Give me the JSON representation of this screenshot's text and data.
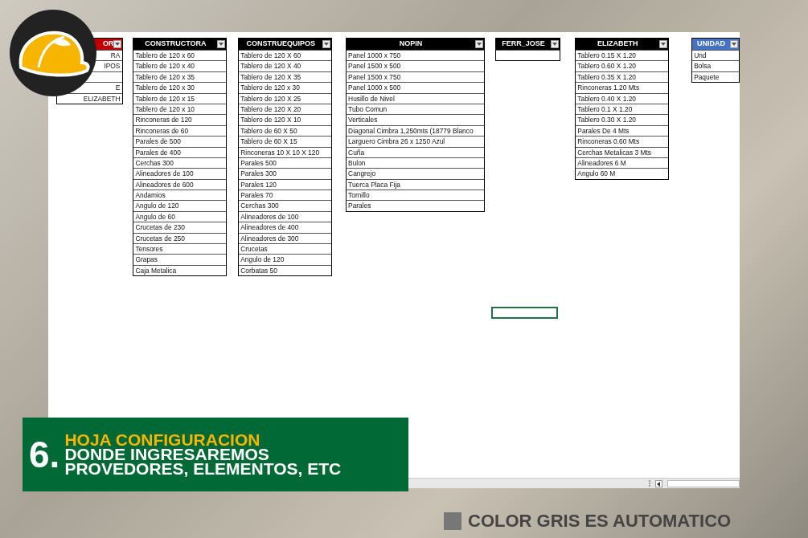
{
  "tables": [
    {
      "header": "OR",
      "color": "#c00000",
      "rows": [
        {
          "text": "RA"
        },
        {
          "text": "IPOS"
        },
        {},
        {
          "text": "E"
        },
        {
          "text": "ELIZABETH"
        }
      ]
    },
    {
      "header": "CONSTRUCTORA",
      "color": "#000000",
      "rows": [
        {
          "text": "Tablero de 120 x 60"
        },
        {
          "text": "Tablero de 120 x 40"
        },
        {
          "text": "Tablero de 120 x 35"
        },
        {
          "text": "Tablero de 120 x 30"
        },
        {
          "text": "Tablero de 120 x 15"
        },
        {
          "text": "Tablero de 120 x 10"
        },
        {
          "text": "Rinconeras de 120"
        },
        {
          "text": "Rinconeras de 60"
        },
        {
          "text": "Parales de 500"
        },
        {
          "text": "Parales de 400"
        },
        {
          "text": "Cerchas 300"
        },
        {
          "text": "Alineadores de 100"
        },
        {
          "text": "Alineadores de 600"
        },
        {
          "text": "Andamios"
        },
        {
          "text": "Angulo de 120"
        },
        {
          "text": "Angulo de 60"
        },
        {
          "text": "Crucetas de 230"
        },
        {
          "text": "Crucetas de 250"
        },
        {
          "text": "Tensores"
        },
        {
          "text": "Grapas"
        },
        {
          "text": "Caja Metalica"
        }
      ]
    },
    {
      "header": "CONSTRUEQUIPOS",
      "color": "#000000",
      "rows": [
        {
          "text": "Tablero de 120 X 60"
        },
        {
          "text": "Tablero de 120 X 40"
        },
        {
          "text": "Tablero de 120 X 35"
        },
        {
          "text": "Tablero de 120 x 30"
        },
        {
          "text": "Tablero de 120 X 25"
        },
        {
          "text": "Tablero de 120 X 20"
        },
        {
          "text": "Tablero de 120 X 10"
        },
        {
          "text": "Tablero de 60 X 50"
        },
        {
          "text": "Tablero de 60 X 15"
        },
        {
          "text": "Rinconeras 10 X 10 X 120"
        },
        {
          "text": "Parales 500"
        },
        {
          "text": "Parales 300"
        },
        {
          "text": "Parales 120"
        },
        {
          "text": "Parales 70"
        },
        {
          "text": "Cerchas 300"
        },
        {
          "text": "Alineadores  de 100"
        },
        {
          "text": "Alineadores  de 400"
        },
        {
          "text": "Alineadores de 300"
        },
        {
          "text": "Crucetas"
        },
        {
          "text": "Angulo de 120"
        },
        {
          "text": "Corbatas  50"
        }
      ]
    },
    {
      "header": "NOPIN",
      "color": "#000000",
      "rows": [
        {
          "text": "Panel 1000 x 750"
        },
        {
          "text": "Panel 1500 x 500"
        },
        {
          "text": "Panel 1500 x 750"
        },
        {
          "text": "Panel 1000 x 500"
        },
        {
          "text": "Husillo de Nivel"
        },
        {
          "text": "Tubo Comun"
        },
        {
          "text": "Verticales"
        },
        {
          "text": "Diagonal Cimbra 1,250mts (18779 Blanco"
        },
        {
          "text": "Larguero Cimbra 26 x 1250 Azul"
        },
        {
          "text": "Cuña"
        },
        {
          "text": "Bulon"
        },
        {
          "text": "Cangrejo"
        },
        {
          "text": "Tuerca Placa Fija"
        },
        {
          "text": "Tornillo"
        },
        {
          "text": "Parales"
        }
      ]
    },
    {
      "header": "FERR_JOSE",
      "color": "#000000",
      "rows": [
        {}
      ]
    },
    {
      "header": "ELIZABETH",
      "color": "#000000",
      "rows": [
        {
          "text": "Tablero 0.15 X 1.20"
        },
        {
          "text": "Tablero 0.60 X 1.20"
        },
        {
          "text": "Tablero 0.35 X 1.20"
        },
        {
          "text": "Rinconeras 1.20 Mts"
        },
        {
          "text": "Tablero 0.40 X 1.20"
        },
        {
          "text": "Tablero 0.1 X 1.20"
        },
        {
          "text": "Tablero 0.30 X 1.20"
        },
        {
          "text": "Parales De 4 Mts"
        },
        {
          "text": "Rinconeras 0.60 Mts"
        },
        {
          "text": "Cerchas Metalicas 3 Mts"
        },
        {
          "text": "Alineadores 6 M"
        },
        {
          "text": "Angulo 60 M"
        }
      ]
    },
    {
      "header": "UNIDAD",
      "color": "#4472c4",
      "rows": [
        {
          "text": "Und"
        },
        {
          "text": "Bolsa"
        },
        {
          "text": "Paquete"
        }
      ]
    }
  ],
  "banner": {
    "number": "6.",
    "title": "HOJA CONFIGURACION",
    "lines": [
      "DONDE INGRESAREMOS",
      "PROVEDORES, ELEMENTOS, ETC"
    ]
  },
  "caption": "COLOR GRIS ES AUTOMATICO"
}
